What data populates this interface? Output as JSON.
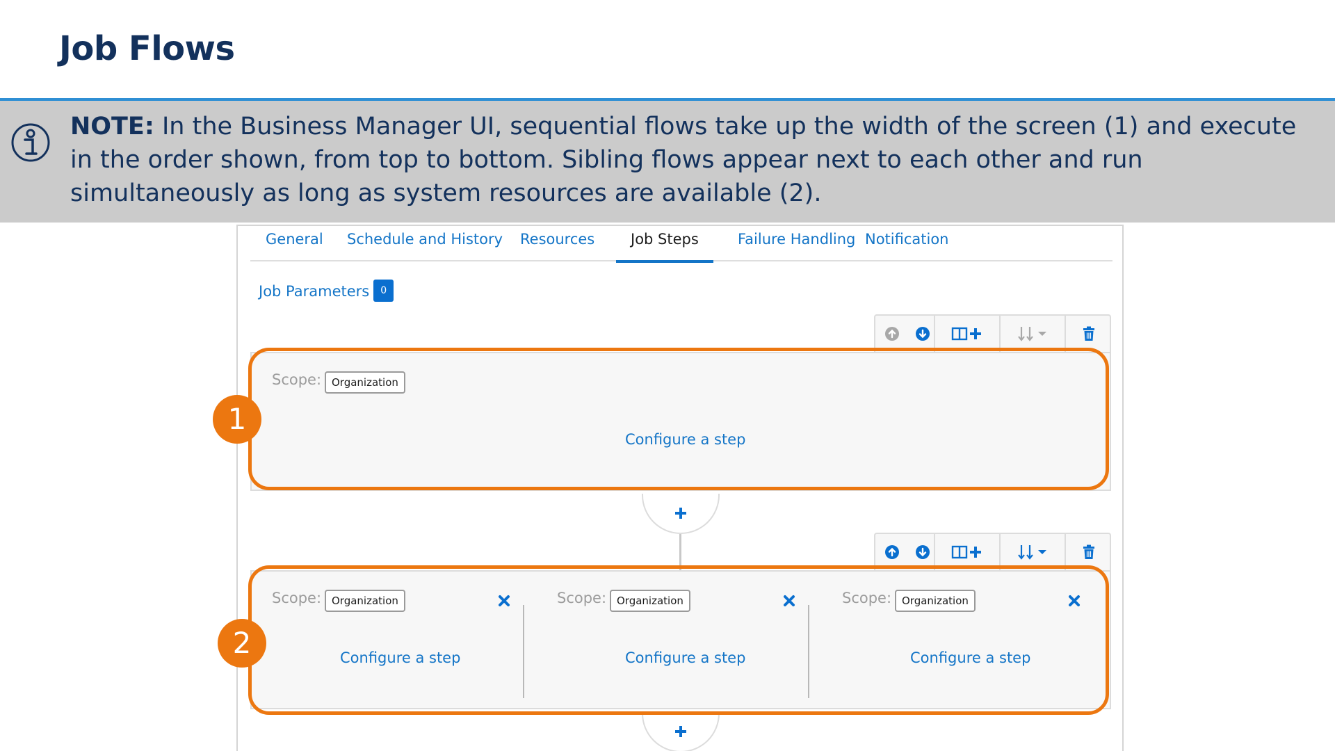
{
  "slide": {
    "title": "Job Flows",
    "note_label": "NOTE:",
    "note_text": "In the Business Manager UI, sequential flows take up the width of the screen (1) and execute in the order shown, from top to bottom. Sibling flows appear next to each other and run simultaneously as long as system resources are available (2)."
  },
  "tabs": [
    {
      "label": "General"
    },
    {
      "label": "Schedule and History"
    },
    {
      "label": "Resources"
    },
    {
      "label": "Job Steps",
      "active": true
    },
    {
      "label": "Failure Handling"
    },
    {
      "label": "Notification"
    }
  ],
  "job_parameters": {
    "label": "Job Parameters",
    "count": "0"
  },
  "flows": [
    {
      "steps": [
        {
          "scope_label": "Scope:",
          "scope_value": "Organization",
          "configure_label": "Configure a step"
        }
      ]
    },
    {
      "steps": [
        {
          "scope_label": "Scope:",
          "scope_value": "Organization",
          "configure_label": "Configure a step"
        },
        {
          "scope_label": "Scope:",
          "scope_value": "Organization",
          "configure_label": "Configure a step"
        },
        {
          "scope_label": "Scope:",
          "scope_value": "Organization",
          "configure_label": "Configure a step"
        }
      ]
    }
  ],
  "callouts": {
    "sequential": "1",
    "sibling": "2"
  },
  "colors": {
    "title": "#13315c",
    "accent_blue": "#1475c7",
    "highlight_orange": "#ec7710",
    "note_band": "#cbcbcb"
  },
  "icons": {
    "note": "info-circle-icon",
    "move_up": "arrow-up-circle-icon",
    "move_down": "arrow-down-circle-icon",
    "add_sibling": "add-column-icon",
    "sort": "sort-dropdown-icon",
    "delete": "trash-icon",
    "close": "close-icon",
    "add_flow": "plus-icon"
  }
}
